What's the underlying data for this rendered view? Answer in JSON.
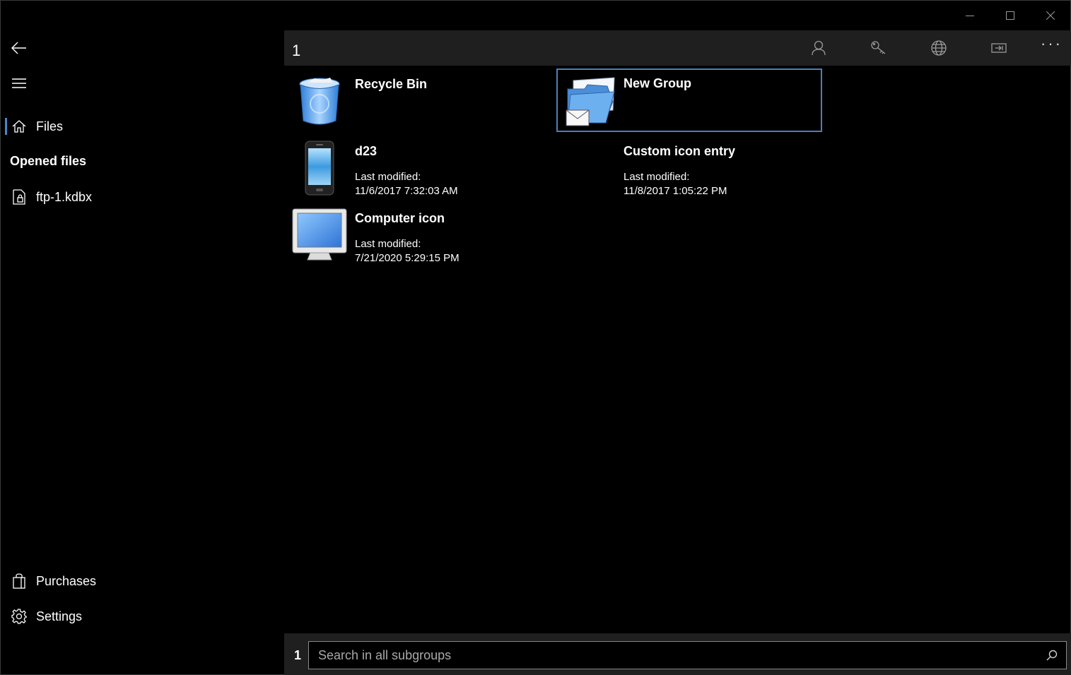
{
  "window": {
    "caption_icons": [
      "minimize-icon",
      "maximize-icon",
      "close-icon"
    ]
  },
  "sidebar": {
    "back_icon": "arrow-left-icon",
    "menu_icon": "hamburger-icon",
    "files_label": "Files",
    "opened_files_title": "Opened files",
    "opened_file": "ftp-1.kdbx",
    "purchases_label": "Purchases",
    "settings_label": "Settings"
  },
  "main": {
    "breadcrumb": "1",
    "toolbar_icons": [
      "person-icon",
      "key-icon",
      "globe-icon",
      "open-url-icon",
      "more-icon"
    ],
    "more_label": "···",
    "items": [
      {
        "title": "Recycle Bin",
        "icon": "recycle-bin-icon"
      },
      {
        "title": "New Group",
        "icon": "folder-mail-icon"
      },
      {
        "title": "d23",
        "modified_label": "Last modified:",
        "modified": "11/6/2017 7:32:03 AM",
        "icon": "phone-icon"
      },
      {
        "title": "Custom icon entry",
        "modified_label": "Last modified:",
        "modified": "11/8/2017 1:05:22 PM"
      },
      {
        "title": "Computer icon",
        "modified_label": "Last modified:",
        "modified": "7/21/2020 5:29:15 PM",
        "icon": "monitor-icon"
      }
    ]
  },
  "bottom": {
    "count": "1",
    "search_placeholder": "Search in all subgroups",
    "search_value": ""
  },
  "colors": {
    "accent": "#4a86c8",
    "bar_bg": "#1f1f1f",
    "background": "#000000"
  }
}
